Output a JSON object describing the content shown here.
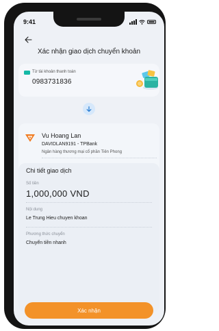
{
  "status_bar": {
    "time": "9:41"
  },
  "header": {
    "title": "Xác nhận giao dịch chuyển khoản"
  },
  "source_account": {
    "label": "Từ tài khoản thanh toán",
    "account_number": "0983731836"
  },
  "recipient": {
    "name": "Vu Hoang Lan",
    "account": "DAVIDLAN9191 - TPBank",
    "bank_name": "Ngân hàng thương mại cổ phần Tiên Phong"
  },
  "details": {
    "heading": "Chi tiết giao dịch",
    "amount_label": "Số tiền",
    "amount_value": "1,000,000 VND",
    "content_label": "Nội dung",
    "content_value": "Le Trung Hieu chuyen khoan",
    "method_label": "Phương thức chuyển",
    "method_value": "Chuyển tiền nhanh"
  },
  "actions": {
    "confirm_label": "Xác nhận"
  },
  "colors": {
    "accent": "#f39229",
    "wallet_teal": "#14b8a6",
    "arrow_blue": "#2d7fd3",
    "bank_orange": "#f07a1f"
  },
  "icons": [
    "back-arrow-icon",
    "wallet-icon",
    "wallet-illustration",
    "arrow-down-icon",
    "tpbank-logo",
    "signal-icon",
    "wifi-icon",
    "battery-icon"
  ]
}
